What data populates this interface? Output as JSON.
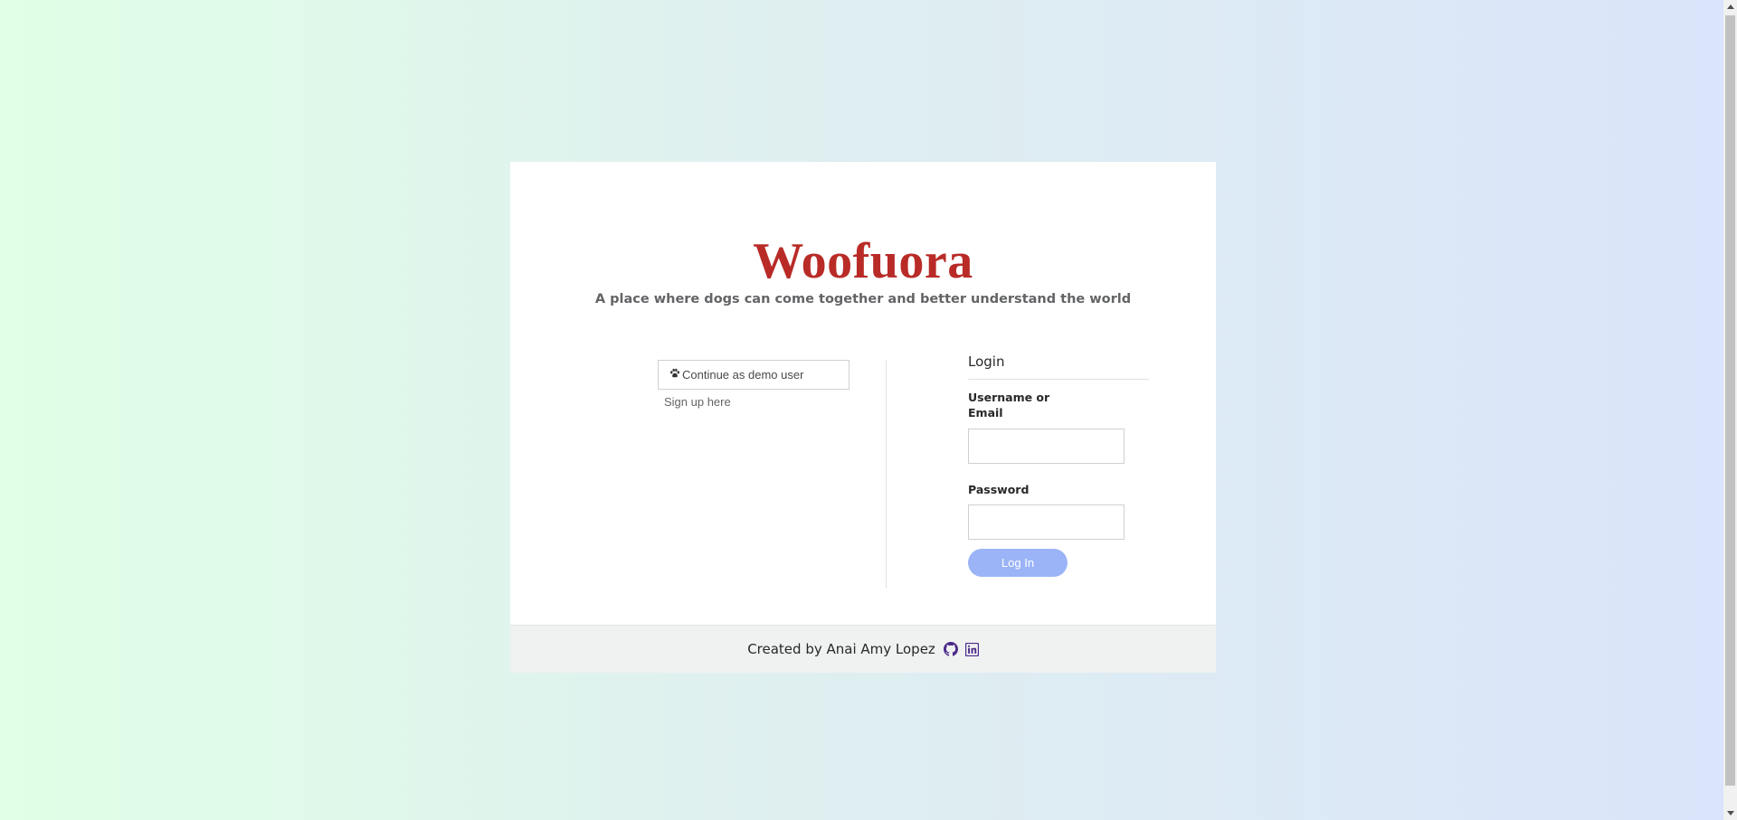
{
  "app": {
    "title": "Woofuora",
    "tagline": "A place where dogs can come together and better understand the world",
    "brand_color": "#b92b27"
  },
  "left_panel": {
    "demo_button_label": "Continue as demo user",
    "demo_button_icon": "paw-icon",
    "signup_link": "Sign up here"
  },
  "login_form": {
    "heading": "Login",
    "username_label": "Username or Email",
    "username_value": "",
    "password_label": "Password",
    "password_value": "",
    "submit_label": "Log In",
    "submit_color": "#9bb4f7"
  },
  "footer": {
    "credit": "Created by Anai Amy Lopez",
    "icons": [
      "github-icon",
      "linkedin-icon"
    ],
    "icon_color": "#4b2a8a"
  }
}
